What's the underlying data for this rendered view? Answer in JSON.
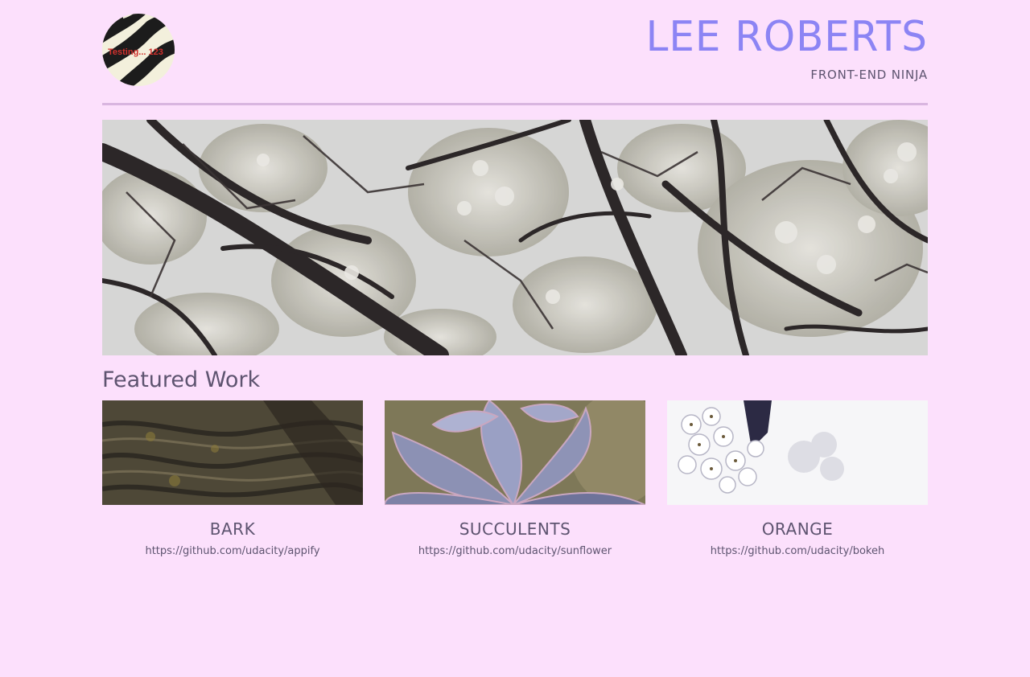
{
  "header": {
    "logo_text": "Testing... 123",
    "name": "LEE ROBERTS",
    "tagline": "FRONT-END NINJA"
  },
  "featured": {
    "heading": "Featured Work",
    "projects": [
      {
        "title": "BARK",
        "url": "https://github.com/udacity/appify"
      },
      {
        "title": "SUCCULENTS",
        "url": "https://github.com/udacity/sunflower"
      },
      {
        "title": "ORANGE",
        "url": "https://github.com/udacity/bokeh"
      }
    ]
  },
  "colors": {
    "background": "#fce0fc",
    "accent": "#8c84f4",
    "text": "#5e5470",
    "rule": "#d9b5e0"
  }
}
